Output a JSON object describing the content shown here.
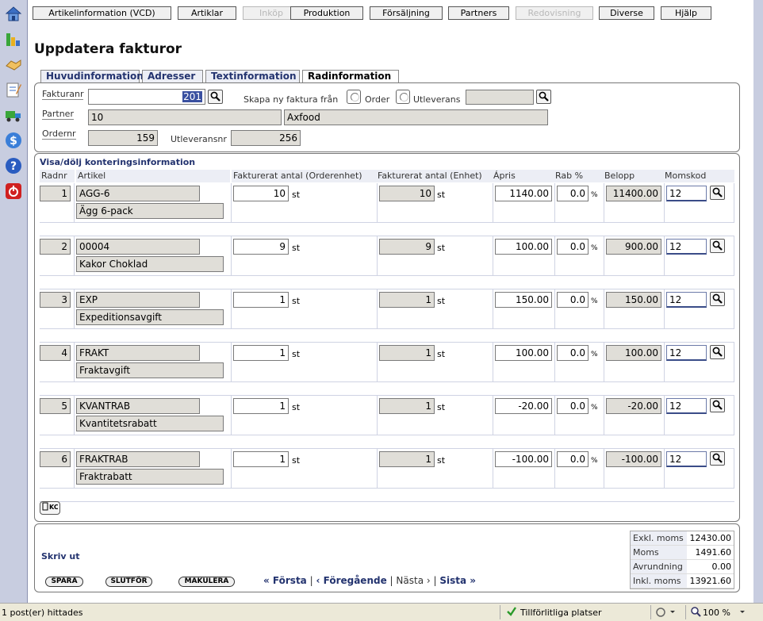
{
  "sidebar": {
    "icons": [
      "home-icon",
      "chart-icon",
      "handshake-icon",
      "notepad-icon",
      "truck-icon",
      "dollar-icon",
      "help-icon",
      "power-icon"
    ]
  },
  "nav": {
    "tabs": [
      {
        "label": "Artikelinformation (VCD)",
        "disabled": false
      },
      {
        "label": "Artiklar",
        "disabled": false
      },
      {
        "label": "Inköp",
        "disabled": true
      },
      {
        "label": "Produktion",
        "disabled": false
      },
      {
        "label": "Försäljning",
        "disabled": false
      },
      {
        "label": "Partners",
        "disabled": false
      },
      {
        "label": "Redovisning",
        "disabled": true
      },
      {
        "label": "Diverse",
        "disabled": false
      },
      {
        "label": "Hjälp",
        "disabled": false
      }
    ]
  },
  "page": {
    "title": "Uppdatera fakturor"
  },
  "tabs": [
    "Huvudinformation",
    "Adresser",
    "Textinformation",
    "Radinformation"
  ],
  "header": {
    "fakturanr_label": "Fakturanr",
    "fakturanr_value": "201",
    "skapa_label": "Skapa ny faktura från",
    "order_label": "Order",
    "utleverans_label": "Utleverans",
    "utleverans_value": "",
    "partner_label": "Partner",
    "partner_id": "10",
    "partner_name": "Axfood",
    "ordernr_label": "Ordernr",
    "ordernr_value": "159",
    "utleveransnr_label": "Utleveransnr",
    "utleveransnr_value": "256"
  },
  "rows_section": {
    "toggle_link": "Visa/dölj konteringsinformation",
    "columns": [
      "Radnr",
      "Artikel",
      "Fakturerat antal (Orderenhet)",
      "Fakturerat antal (Enhet)",
      "Ápris",
      "Rab %",
      "Belopp",
      "Momskod"
    ],
    "rows": [
      {
        "radnr": "1",
        "artikel": "AGG-6",
        "beskrivning": "Ägg 6-pack",
        "antal_order": "10",
        "antal_enhet": "10",
        "apris": "1140.00",
        "rab": "0.0",
        "belopp": "11400.00",
        "momskod": "12"
      },
      {
        "radnr": "2",
        "artikel": "00004",
        "beskrivning": "Kakor Choklad",
        "antal_order": "9",
        "antal_enhet": "9",
        "apris": "100.00",
        "rab": "0.0",
        "belopp": "900.00",
        "momskod": "12"
      },
      {
        "radnr": "3",
        "artikel": "EXP",
        "beskrivning": "Expeditionsavgift",
        "antal_order": "1",
        "antal_enhet": "1",
        "apris": "150.00",
        "rab": "0.0",
        "belopp": "150.00",
        "momskod": "12"
      },
      {
        "radnr": "4",
        "artikel": "FRAKT",
        "beskrivning": "Fraktavgift",
        "antal_order": "1",
        "antal_enhet": "1",
        "apris": "100.00",
        "rab": "0.0",
        "belopp": "100.00",
        "momskod": "12"
      },
      {
        "radnr": "5",
        "artikel": "KVANTRAB",
        "beskrivning": "Kvantitetsrabatt",
        "antal_order": "1",
        "antal_enhet": "1",
        "apris": "-20.00",
        "rab": "0.0",
        "belopp": "-20.00",
        "momskod": "12"
      },
      {
        "radnr": "6",
        "artikel": "FRAKTRAB",
        "beskrivning": "Fraktrabatt",
        "antal_order": "1",
        "antal_enhet": "1",
        "apris": "-100.00",
        "rab": "0.0",
        "belopp": "-100.00",
        "momskod": "12"
      }
    ],
    "unit": "st",
    "percent": "%"
  },
  "footer": {
    "skriv_ut": "Skriv ut",
    "buttons": {
      "spara": "SPARA",
      "slutfor": "SLUTFÖR",
      "makulera": "MAKULERA"
    },
    "pager": {
      "first": "« Första",
      "prev": "‹ Föregående",
      "next": "Nästa ›",
      "last": "Sista »",
      "sep": "|"
    },
    "totals": [
      {
        "label": "Exkl. moms",
        "value": "12430.00"
      },
      {
        "label": "Moms",
        "value": "1491.60"
      },
      {
        "label": "Avrundning",
        "value": "0.00"
      },
      {
        "label": "Inkl. moms",
        "value": "13921.60"
      }
    ]
  },
  "statusbar": {
    "left": "1 post(er) hittades",
    "zone": "Tillförlitliga platser",
    "zoom": "100 %"
  }
}
